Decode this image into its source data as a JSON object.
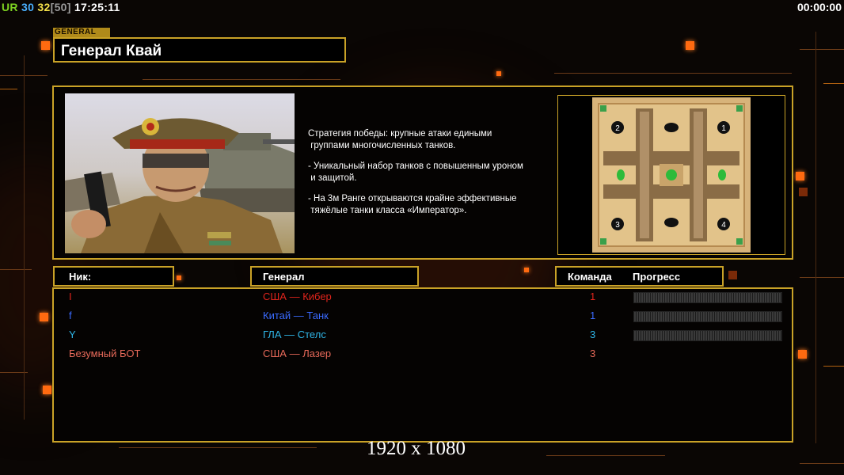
{
  "topbar": {
    "ur": "UR",
    "val1": "30",
    "val2": "32",
    "val3": "[50]",
    "clock": "17:25:11",
    "timer": "00:00:00"
  },
  "general": {
    "tag": "GENERAL",
    "name": "Генерал Квай",
    "portrait_icon": "general-kwai-portrait",
    "description": [
      "Стратегия победы: крупные атаки едиными\n группами многочисленных танков.",
      "- Уникальный набор танков с повышенным уроном\n и защитой.",
      "- На 3м Ранге открываются крайне эффективные\n тяжёлые танки класса «Император»."
    ]
  },
  "map": {
    "icon": "tournament-desert-minimap",
    "starts": [
      "1",
      "2",
      "3",
      "4"
    ]
  },
  "columns": {
    "nick": "Ник:",
    "general": "Генерал",
    "team": "Команда",
    "progress": "Прогресс"
  },
  "players": [
    {
      "nick": "I",
      "general": "США — Кибер",
      "team": "1",
      "color": "#e0241c",
      "progress": 0
    },
    {
      "nick": "f",
      "general": "Китай — Танк",
      "team": "1",
      "color": "#3a6bff",
      "progress": 0
    },
    {
      "nick": "Y",
      "general": "ГЛА — Стелс",
      "team": "3",
      "color": "#2fb6e8",
      "progress": 0
    },
    {
      "nick": "Безумный БОТ",
      "general": "США — Лазер",
      "team": "3",
      "color": "#e86a5a",
      "progress": null
    }
  ],
  "overlay": {
    "resolution": "1920 x 1080"
  }
}
